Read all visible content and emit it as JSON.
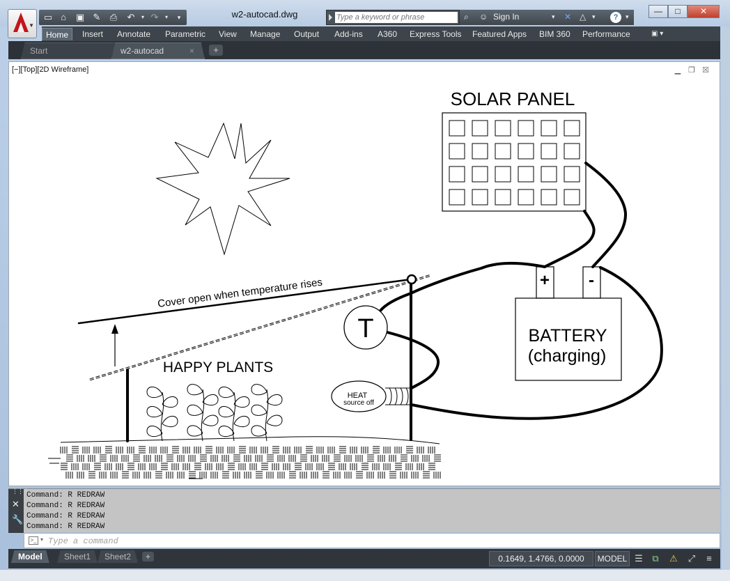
{
  "window": {
    "document_title": "w2-autocad.dwg",
    "controls": {
      "minimize": "—",
      "maximize": "□",
      "close": "✕"
    }
  },
  "titlebar": {
    "search_placeholder": "Type a keyword or phrase",
    "sign_in": "Sign In",
    "help": "?"
  },
  "ribbon": {
    "tabs": [
      "Home",
      "Insert",
      "Annotate",
      "Parametric",
      "View",
      "Manage",
      "Output",
      "Add-ins",
      "A360",
      "Express Tools",
      "Featured Apps",
      "BIM 360",
      "Performance"
    ],
    "active_tab": "Home"
  },
  "doc_tabs": {
    "start": "Start",
    "file": "w2-autocad",
    "close": "×",
    "add": "+"
  },
  "viewport": {
    "label": "[−][Top][2D Wireframe]"
  },
  "drawing": {
    "solar_panel_title": "SOLAR PANEL",
    "battery_line1": "BATTERY",
    "battery_line2": "(charging)",
    "plus": "+",
    "minus": "-",
    "thermostat": "T",
    "heat_line1": "HEAT",
    "heat_line2": "source off",
    "plants_label": "HAPPY PLANTS",
    "cover_label": "Cover open when temperature rises"
  },
  "command": {
    "history": [
      "Command: R REDRAW",
      "Command: R REDRAW",
      "Command: R REDRAW",
      "Command: R REDRAW"
    ],
    "input_placeholder": "Type a command"
  },
  "statusbar": {
    "layout_tabs": [
      "Model",
      "Sheet1",
      "Sheet2"
    ],
    "add": "+",
    "coordinates": "0.1649, 1.4766, 0.0000",
    "space": "MODEL"
  },
  "colors": {
    "autocad_red": "#c4151c",
    "dark_ui": "#3d444b"
  }
}
